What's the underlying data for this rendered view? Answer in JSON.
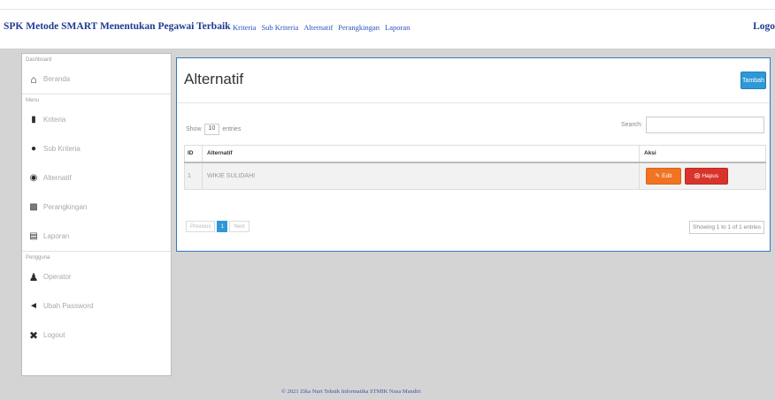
{
  "topbar": {
    "brand": "SPK Metode SMART Menentukan Pegawai Terbaik",
    "nav": [
      "Kriteria",
      "Sub Kriteria",
      "Alternatif",
      "Perangkingan",
      "Laporan"
    ],
    "logout": "Logo"
  },
  "sidebar": {
    "sections": [
      {
        "heading": "Dashboard",
        "items": [
          {
            "label": "Beranda",
            "icon": "home-icon"
          }
        ]
      },
      {
        "heading": "Menu",
        "items": [
          {
            "label": "Kriteria",
            "icon": "tag-icon"
          },
          {
            "label": "Sub Kriteria",
            "icon": "pin-icon"
          },
          {
            "label": "Alternatif",
            "icon": "users-icon"
          },
          {
            "label": "Perangkingan",
            "icon": "bar-chart-icon"
          },
          {
            "label": "Laporan",
            "icon": "document-icon"
          }
        ]
      },
      {
        "heading": "Pengguna",
        "items": [
          {
            "label": "Operator",
            "icon": "user-icon"
          },
          {
            "label": "Ubah Password",
            "icon": "key-icon"
          },
          {
            "label": "Logout",
            "icon": "close-icon"
          }
        ]
      }
    ]
  },
  "panel": {
    "title": "Alternatif",
    "add_button": "Tambah",
    "show_prefix": "Show",
    "show_value": "10",
    "show_suffix": "entries",
    "search_label": "Search:",
    "search_value": "",
    "columns": [
      "ID",
      "Alternatif",
      "Aksi"
    ],
    "rows": [
      {
        "id": "1",
        "alternatif": "WIKIE SULIDAHI",
        "edit_label": "Edit",
        "delete_label": "Hapus"
      }
    ],
    "pagination": {
      "previous": "Previous",
      "current": "1",
      "next": "Next"
    },
    "info": "Showing 1 to 1 of 1 entries"
  },
  "footer": "© 2021 Zika Nuri Teknik Informatika STMIK Nusa Mandiri",
  "colors": {
    "primary": "#2f98d6",
    "edit": "#f07421",
    "delete": "#d9342b",
    "brand": "#1f3a93"
  }
}
